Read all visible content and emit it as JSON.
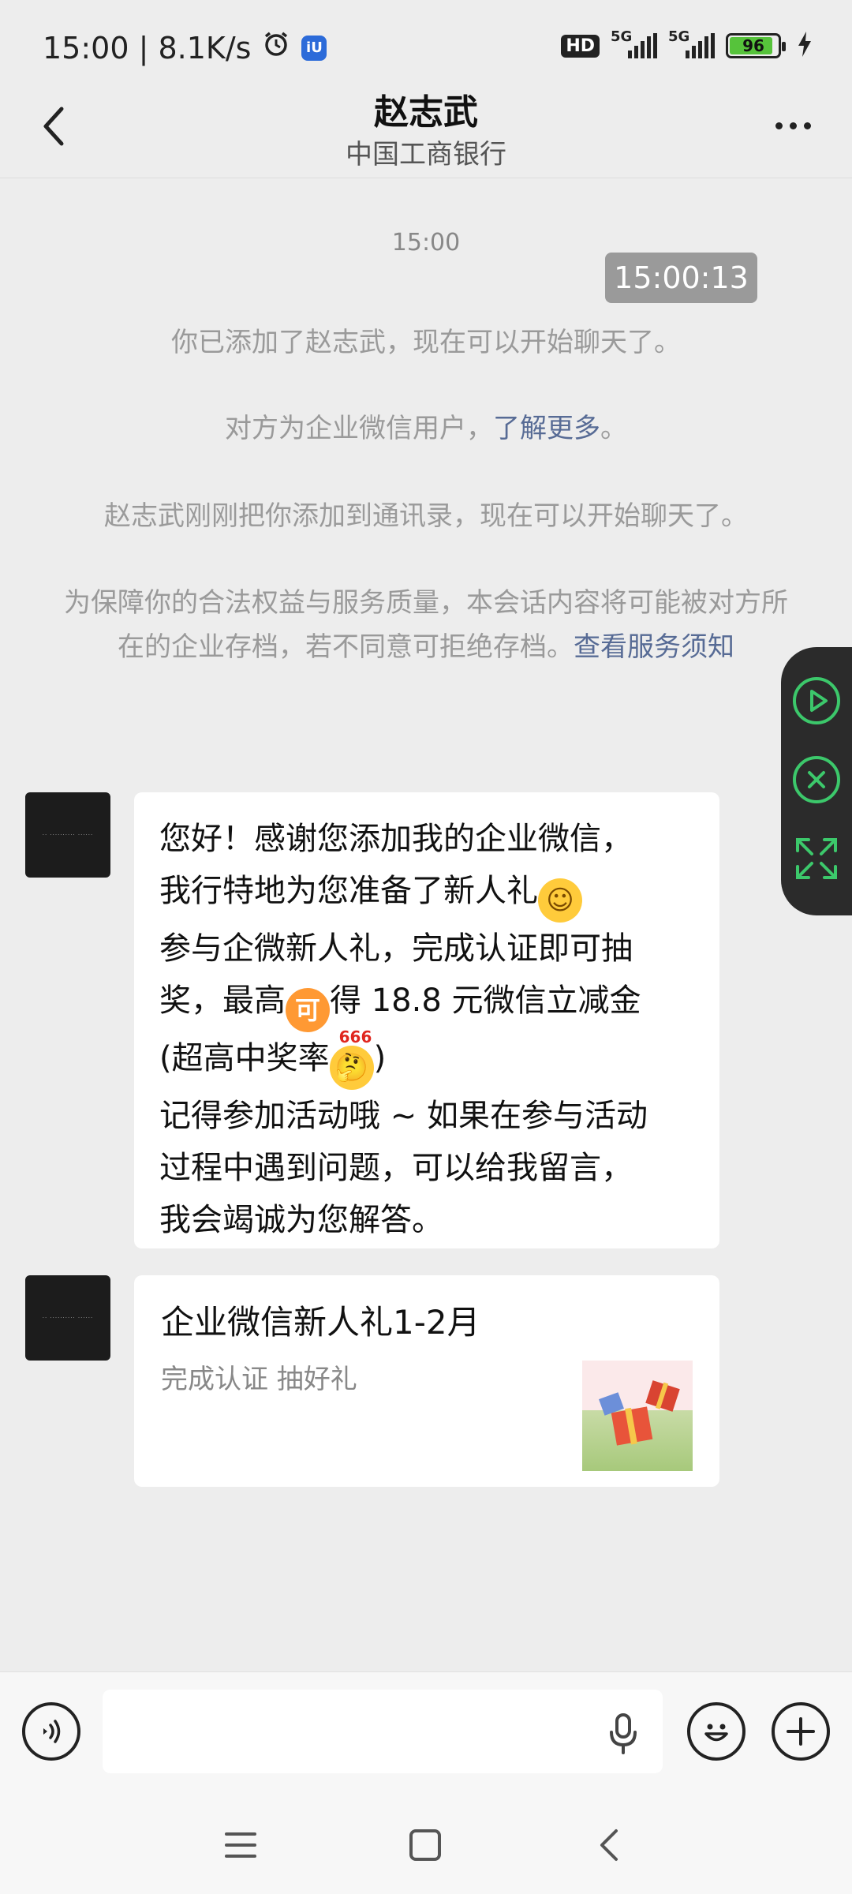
{
  "status_bar": {
    "time_speed": "15:00 | 8.1K/s",
    "app_badge": "iU",
    "hd_label": "HD",
    "network_1": "5G",
    "network_2": "5G",
    "battery": "96",
    "icons": [
      "alarm-icon",
      "app-badge-icon",
      "signal-icon",
      "battery-icon",
      "charging-icon"
    ]
  },
  "header": {
    "title": "赵志武",
    "subtitle": "中国工商银行"
  },
  "chat": {
    "time_label": "15:00",
    "time_tooltip": "15:00:13",
    "system_messages": {
      "added": "你已添加了赵志武，现在可以开始聊天了。",
      "enterprise_prefix": "对方为企业微信用户，",
      "enterprise_link": "了解更多",
      "enterprise_suffix": "。",
      "contact_added": "赵志武刚刚把你添加到通讯录，现在可以开始聊天了。",
      "archive_text": "为保障你的合法权益与服务质量，本会话内容将可能被对方所在的企业存档，若不同意可拒绝存档。",
      "archive_link": "查看服务须知"
    },
    "messages": [
      {
        "type": "text",
        "line1": "您好！感谢您添加我的企业微信，",
        "line2": "我行特地为您准备了新人礼",
        "line3": "参与企微新人礼，完成认证即可抽",
        "line4a": "奖，最高",
        "line4b": "得 18.8 元微信立减金",
        "line5a": "(超高中奖率",
        "line5b": ")",
        "line6": "记得参加活动哦 ~ 如果在参与活动",
        "line7": "过程中遇到问题，可以给我留言，",
        "line8": "我会竭诚为您解答。",
        "emoji_ke": "可",
        "emoji_666": "666"
      },
      {
        "type": "card",
        "title": "企业微信新人礼1-2月",
        "subtitle": "完成认证 抽好礼"
      }
    ]
  },
  "input_bar": {
    "placeholder": ""
  },
  "colors": {
    "background": "#EDEDED",
    "link": "#576b95",
    "float_green": "#3cc86b"
  }
}
